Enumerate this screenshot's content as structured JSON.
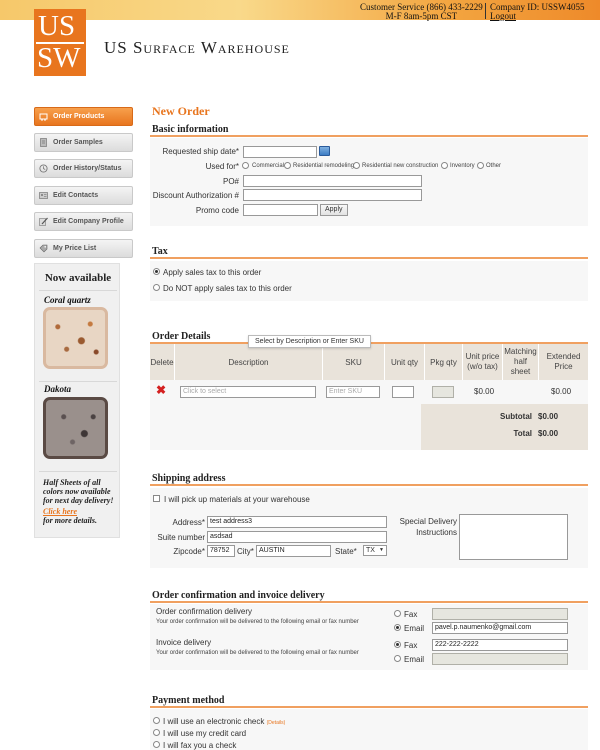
{
  "header": {
    "service_line1": "Customer Service (866) 433-2229",
    "service_line2": "M-F 8am-5pm CST",
    "company_id": "Company ID: USSW4055",
    "logout": "Logout",
    "logo_top": "US",
    "logo_bottom": "SW",
    "brand_name": "US Surface Warehouse"
  },
  "sidebar": {
    "items": [
      {
        "label": "Order Products",
        "icon": "cart-icon"
      },
      {
        "label": "Order Samples",
        "icon": "document-icon"
      },
      {
        "label": "Order History/Status",
        "icon": "history-icon"
      },
      {
        "label": "Edit Contacts",
        "icon": "contacts-icon"
      },
      {
        "label": "Edit Company Profile",
        "icon": "edit-icon"
      },
      {
        "label": "My Price List",
        "icon": "tag-icon"
      }
    ],
    "available": {
      "title": "Now available",
      "stone1": "Coral quartz",
      "stone2": "Dakota",
      "promo_text": "Half Sheets of all colors now available for next day delivery!",
      "promo_link": "Click here",
      "promo_tail": "for more details."
    }
  },
  "main": {
    "title": "New Order",
    "basic": {
      "title": "Basic information",
      "ship_date_label": "Requested ship date*",
      "ship_date_value": "",
      "used_for_label": "Used for*",
      "used_for_options": [
        "Commercial",
        "Residential remodeling",
        "Residential new construction",
        "Inventory",
        "Other"
      ],
      "po_label": "PO#",
      "po_value": "",
      "discount_label": "Discount Authorization #",
      "discount_value": "",
      "promo_label": "Promo code",
      "promo_value": "",
      "apply_label": "Apply"
    },
    "tax": {
      "title": "Tax",
      "option1": "Apply sales tax to this order",
      "option2": "Do NOT apply sales tax to this order"
    },
    "order": {
      "title": "Order Details",
      "tooltip": "Select by Description or Enter SKU",
      "headers": {
        "delete": "Delete",
        "description": "Description",
        "sku": "SKU",
        "unit_qty": "Unit qty",
        "pkg_qty": "Pkg qty",
        "unit_price_1": "Unit price",
        "unit_price_2": "(w/o tax)",
        "matching_1": "Matching",
        "matching_2": "half",
        "matching_3": "sheet",
        "extended_1": "Extended",
        "extended_2": "Price"
      },
      "row": {
        "description_placeholder": "Click to select",
        "sku_placeholder": "Enter SKU",
        "unit_price": "$0.00",
        "extended_price": "$0.00"
      },
      "subtotal_label": "Subtotal",
      "subtotal_value": "$0.00",
      "total_label": "Total",
      "total_value": "$0.00"
    },
    "shipping": {
      "title": "Shipping address",
      "pickup_label": "I will pick up materials at your warehouse",
      "address_label": "Address*",
      "address_value": "test address3",
      "suite_label": "Suite number",
      "suite_value": "asdsad",
      "zip_label": "Zipcode*",
      "zip_value": "78752",
      "city_label": "City*",
      "city_value": "AUSTIN",
      "state_label": "State*",
      "state_value": "TX",
      "special_label_1": "Special Delivery",
      "special_label_2": "Instructions",
      "special_value": ""
    },
    "confirmation": {
      "title": "Order confirmation and invoice delivery",
      "order_label": "Order confirmation delivery",
      "order_note": "Your order confirmation will be delivered to the following email or fax number",
      "invoice_label": "Invoice delivery",
      "invoice_note": "Your order confirmation will be delivered to the following email or fax number",
      "fax_label": "Fax",
      "email_label": "Email",
      "order_fax_value": "",
      "order_email_value": "pavel.p.naumenko@gmail.com",
      "invoice_fax_value": "222-222-2222",
      "invoice_email_value": ""
    },
    "payment": {
      "title": "Payment method",
      "option1": "I will use an electronic check",
      "details": "(Details)",
      "option2": "I will use my credit card",
      "option3": "I will fax you a check"
    }
  },
  "colors": {
    "accent": "#e8751e",
    "panel": "#f7f7f7",
    "table_header": "#e9e3da"
  }
}
